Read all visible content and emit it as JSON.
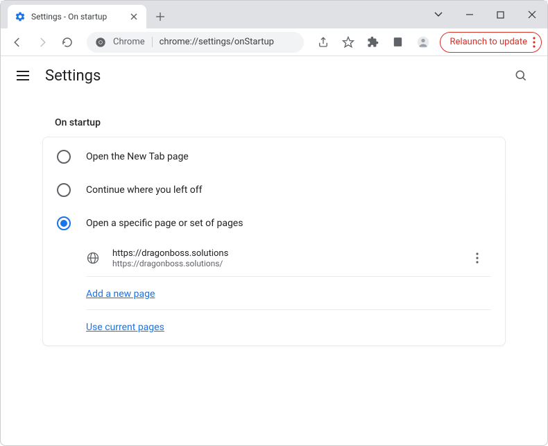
{
  "window": {
    "tab_title": "Settings - On startup"
  },
  "toolbar": {
    "omnibox_prefix": "Chrome",
    "omnibox_url": "chrome://settings/onStartup",
    "relaunch_label": "Relaunch to update"
  },
  "settings": {
    "header_title": "Settings",
    "section_title": "On startup",
    "options": {
      "new_tab": "Open the New Tab page",
      "continue": "Continue where you left off",
      "specific": "Open a specific page or set of pages"
    },
    "startup_page": {
      "title": "https://dragonboss.solutions",
      "url": "https://dragonboss.solutions/"
    },
    "add_new_page": "Add a new page",
    "use_current": "Use current pages"
  }
}
